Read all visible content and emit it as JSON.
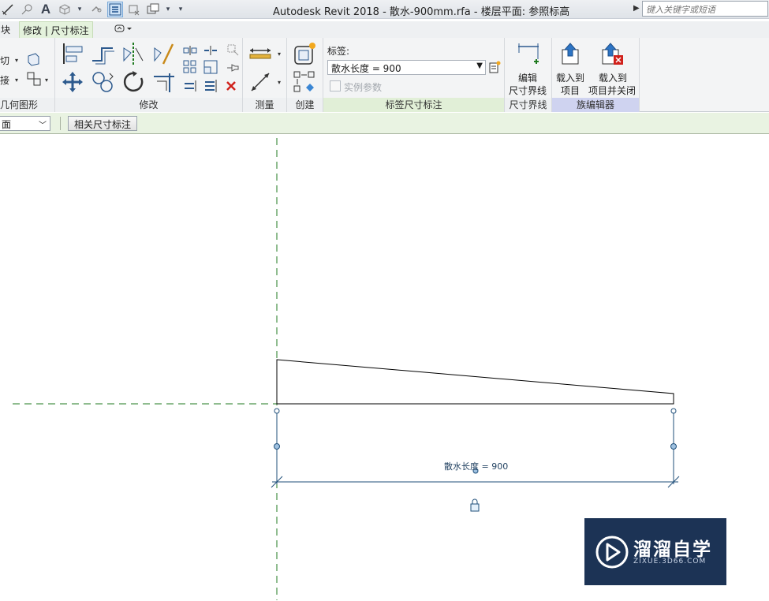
{
  "window": {
    "title": "Autodesk Revit 2018 -     散水-900mm.rfa - 楼层平面: 参照标高",
    "search_placeholder": "键入关键字或短语"
  },
  "tabs": [
    {
      "label": "块"
    },
    {
      "label": "修改 | 尺寸标注"
    }
  ],
  "ribbon": {
    "panels": {
      "geometry": {
        "title": "几何图形",
        "cut_label": "切",
        "join_label": "接"
      },
      "modify": {
        "title": "修改"
      },
      "measure": {
        "title": "测量"
      },
      "create": {
        "title": "创建"
      },
      "label_dim": {
        "title": "标签尺寸标注",
        "label_caption": "标签:",
        "label_value": "散水长度 = 900",
        "instance_param": "实例参数"
      },
      "witness": {
        "title": "尺寸界线",
        "edit_line1": "编辑",
        "edit_line2": "尺寸界线"
      },
      "family_editor": {
        "title": "族编辑器",
        "load_line1": "载入到",
        "load_line2": "项目",
        "load_close_line1": "载入到",
        "load_close_line2": "项目并关闭"
      }
    }
  },
  "options_bar": {
    "view_value": "面",
    "related_button": "相关尺寸标注"
  },
  "canvas": {
    "dimension_label": "散水长度 = 900"
  },
  "watermark": {
    "brand": "溜溜自学",
    "domain": "ZIXUE.3D66.COM"
  },
  "colors": {
    "ribbon_green": "#e1efd7",
    "family_editor_purple": "#cfd3f0",
    "reference_line_green": "#1f7a1f",
    "dimension_blue": "#1f4f7a",
    "watermark_bg": "#1c3355"
  }
}
